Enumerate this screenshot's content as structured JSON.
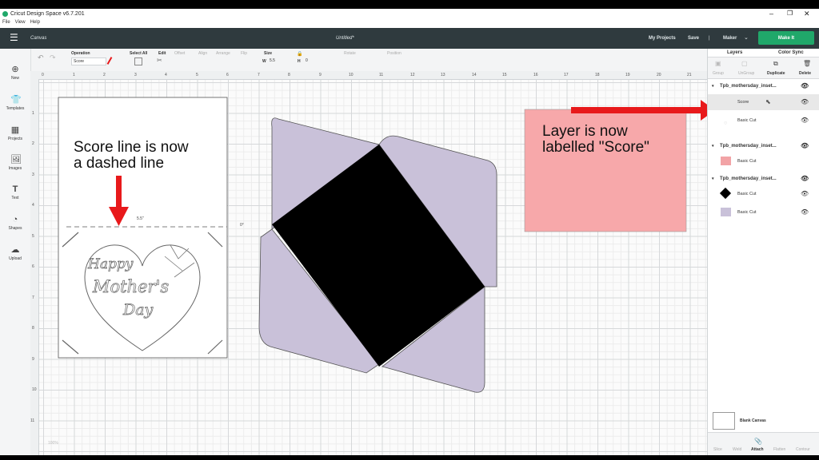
{
  "window": {
    "title": "Cricut Design Space  v6.7.201",
    "menu": [
      "File",
      "View",
      "Help"
    ]
  },
  "header": {
    "section": "Canvas",
    "doc_title": "Untitled*",
    "my_projects": "My Projects",
    "save": "Save",
    "divider": "|",
    "machine": "Maker",
    "make_it": "Make It"
  },
  "toolbar": {
    "operation_label": "Operation",
    "operation_value": "Score",
    "select_all": "Select All",
    "edit": "Edit",
    "offset": "Offset",
    "align": "Align",
    "arrange": "Arrange",
    "flip": "Flip",
    "size_label": "Size",
    "w_label": "W",
    "w_value": "5.5",
    "h_label": "H",
    "h_value": "0",
    "rotate": "Rotate",
    "position": "Position"
  },
  "sidebar": {
    "items": [
      "New",
      "Templates",
      "Projects",
      "Images",
      "Text",
      "Shapes",
      "Upload"
    ]
  },
  "ruler": {
    "h": [
      "0",
      "1",
      "2",
      "3",
      "4",
      "5",
      "6",
      "7",
      "8",
      "9",
      "10",
      "11",
      "12",
      "13",
      "14",
      "15",
      "16",
      "17",
      "18",
      "19",
      "20",
      "21"
    ],
    "v": [
      "1",
      "2",
      "3",
      "4",
      "5",
      "6",
      "7",
      "8",
      "9",
      "10",
      "11"
    ]
  },
  "canvas": {
    "card_text": [
      "Happy",
      "Mother's",
      "Day"
    ],
    "dim_label": "5.5\"",
    "zero_label": "0°",
    "callout_left": [
      "Score line is now",
      "a dashed line"
    ],
    "callout_right": [
      "Layer is now",
      "labelled \"Score\""
    ],
    "zoom": "100%"
  },
  "panel": {
    "tabs": [
      "Layers",
      "Color Sync"
    ],
    "actions": [
      "Group",
      "UnGroup",
      "Duplicate",
      "Delete"
    ],
    "groups": [
      {
        "name": "Tpb_mothersday_inset...",
        "rows": [
          {
            "name": "Score"
          },
          {
            "name": "Basic Cut"
          }
        ]
      },
      {
        "name": "Tpb_mothersday_inset...",
        "rows": [
          {
            "name": "Basic Cut"
          }
        ]
      },
      {
        "name": "Tpb_mothersday_inset...",
        "rows": [
          {
            "name": "Basic Cut"
          },
          {
            "name": "Basic Cut"
          }
        ]
      }
    ],
    "blank_canvas": "Blank Canvas",
    "bottom_actions": [
      "Slice",
      "Weld",
      "Attach",
      "Flatten",
      "Contour"
    ]
  },
  "colors": {
    "header": "#2f3a3e",
    "make": "#20a86a",
    "envelope": "#c9c1d9",
    "callout_box": "#f7a8aa",
    "arrow": "#e8191b",
    "swatch_pink": "#f2a3a6",
    "swatch_lilac": "#c9c1d9"
  }
}
